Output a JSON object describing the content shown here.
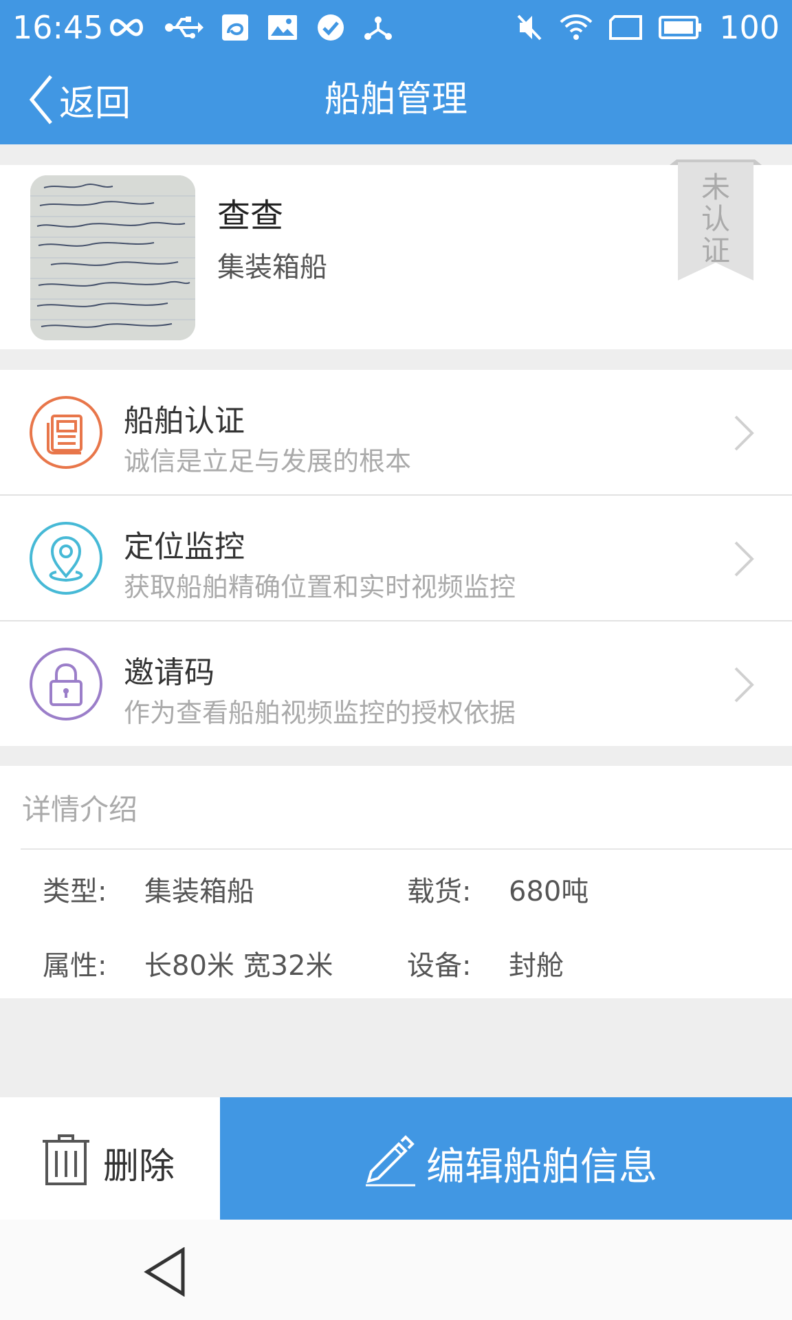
{
  "status_bar": {
    "time": "16:45",
    "battery": "100",
    "left_icons": [
      "infinity-icon",
      "usb-icon",
      "browser-app-icon",
      "image-icon",
      "check-circle-icon",
      "share-network-icon"
    ],
    "right_icons": [
      "mute-icon",
      "wifi-icon",
      "rotate-icon",
      "battery-icon"
    ]
  },
  "nav": {
    "back_label": "返回",
    "title": "船舶管理"
  },
  "ship": {
    "name": "查查",
    "type": "集装箱船",
    "certification_badge": "未认证"
  },
  "menu": [
    {
      "title": "船舶认证",
      "subtitle": "诚信是立足与发展的根本",
      "icon": "certificate-document-icon",
      "color": "#e8764a"
    },
    {
      "title": "定位监控",
      "subtitle": "获取船舶精确位置和实时视频监控",
      "icon": "location-pin-icon",
      "color": "#46b9d6"
    },
    {
      "title": "邀请码",
      "subtitle": "作为查看船舶视频监控的授权依据",
      "icon": "lock-icon",
      "color": "#9b7ec9"
    }
  ],
  "details": {
    "header": "详情介绍",
    "type_label": "类型:",
    "type_value": "集装箱船",
    "cargo_label": "载货:",
    "cargo_value": "680吨",
    "attr_label": "属性:",
    "attr_value": "长80米 宽32米",
    "equip_label": "设备:",
    "equip_value": "封舱"
  },
  "actions": {
    "delete_label": "删除",
    "edit_label": "编辑船舶信息"
  },
  "colors": {
    "primary": "#4197e3",
    "background": "#eeeeee"
  }
}
